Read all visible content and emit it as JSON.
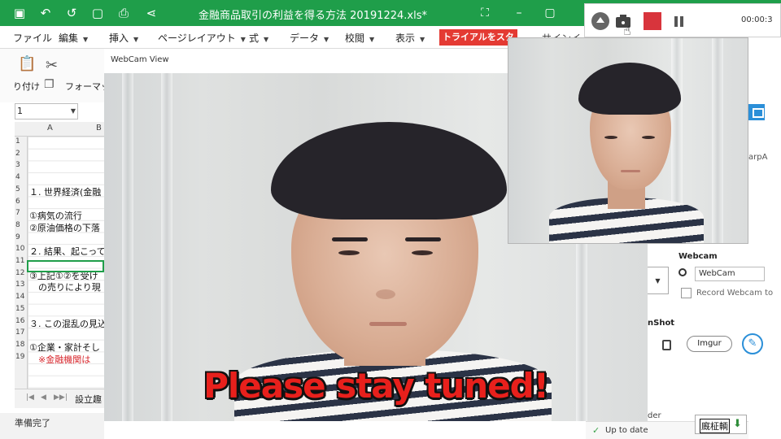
{
  "excel": {
    "title": "金融商品取引の利益を得る方法 20191224.xls*",
    "menu": [
      {
        "label": "ファイル",
        "caret": false
      },
      {
        "label": "編集",
        "caret": true
      },
      {
        "label": "挿入",
        "caret": true
      },
      {
        "label": "ページレイアウト",
        "caret": true
      },
      {
        "label": "式",
        "caret": true
      },
      {
        "label": "データ",
        "caret": true
      },
      {
        "label": "校閲",
        "caret": true
      },
      {
        "label": "表示",
        "caret": true
      }
    ],
    "trial_button": "トライアルをスタート",
    "signin_partial": "サインイ",
    "ribbon": {
      "paste_label": "り付け",
      "format_label": "フォーマット"
    },
    "name_box": "1",
    "columns": [
      "A",
      "B"
    ],
    "rows": [
      "1",
      "2",
      "3",
      "4",
      "5",
      "6",
      "7",
      "8",
      "9",
      "10",
      "11",
      "12",
      "13",
      "14",
      "15",
      "16",
      "17",
      "18",
      "19"
    ],
    "cells": [
      {
        "row": 5,
        "text": "１. 世界経済(金融",
        "red": false
      },
      {
        "row": 7,
        "text": "①病気の流行",
        "red": false
      },
      {
        "row": 8,
        "text": "②原油価格の下落",
        "red": false
      },
      {
        "row": 10,
        "text": "２. 結果、起こって",
        "red": false
      },
      {
        "row": 12,
        "text": "③上記①②を受け",
        "red": false
      },
      {
        "row": 13,
        "text": "　の売りにより現",
        "red": false
      },
      {
        "row": 16,
        "text": "３. この混乱の見込",
        "red": false
      },
      {
        "row": 18,
        "text": "①企業・家計そし",
        "red": false
      },
      {
        "row": 19,
        "text": "　※金融機関は",
        "red": true
      }
    ],
    "sheet_tab": "設立趣",
    "status": "準備完了"
  },
  "webcam": {
    "window_title": "WebCam View",
    "caption": "Please stay tuned!"
  },
  "recorder": {
    "time": "00:00:3",
    "accent_stop": "#d8343c"
  },
  "settings": {
    "webcam_title": "Webcam",
    "webcam_device": "WebCam",
    "record_webcam_label": "Record Webcam to",
    "screenshot_title": "nShot",
    "imgur_label": "Imgur",
    "order_label": "der",
    "side_label": "arpA",
    "update_status": "Up to date",
    "ime_text": "廐柾輌"
  },
  "colors": {
    "excel_green": "#1f9e4a",
    "caption_red": "#e8201c",
    "accent_blue": "#2b8fd8"
  }
}
